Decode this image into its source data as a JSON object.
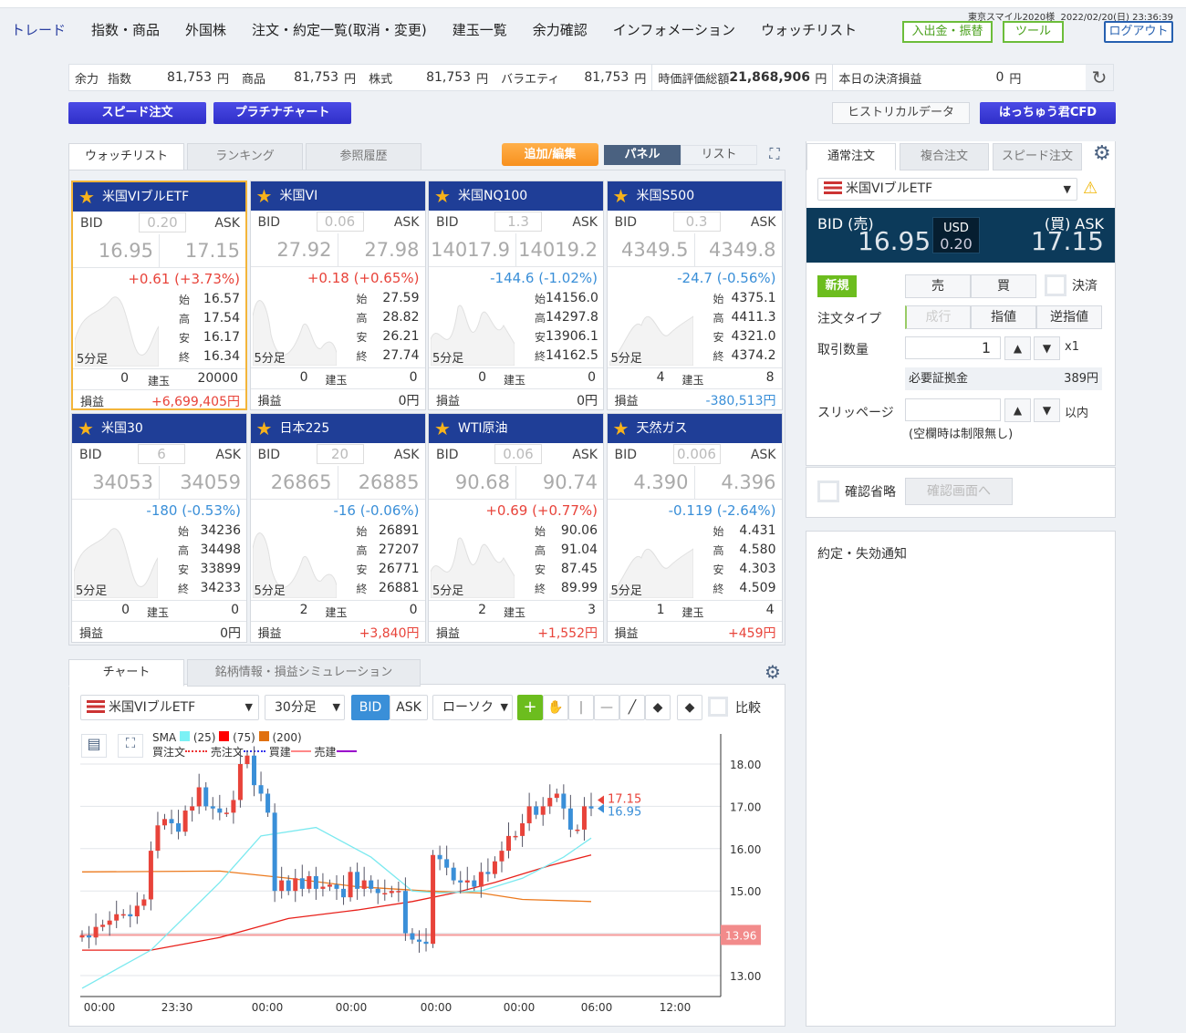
{
  "header": {
    "nav": [
      "トレード",
      "指数・商品",
      "外国株",
      "注文・約定一覧(取消・変更)",
      "建玉一覧",
      "余力確認",
      "インフォメーション",
      "ウォッチリスト"
    ],
    "user": "東京スマイル2020様",
    "datetime": "2022/02/20(日) 23:36:39",
    "deposit_btn": "入出金・振替",
    "tools_btn": "ツール",
    "logout_btn": "ログアウト"
  },
  "margin": {
    "label": "余力",
    "idx_label": "指数",
    "idx": "81,753",
    "com_label": "商品",
    "com": "81,753",
    "stk_label": "株式",
    "stk": "81,753",
    "var_label": "バラエティ",
    "var": "81,753",
    "yen": "円",
    "mv_label": "時価評価総額",
    "mv": "21,868,906",
    "pl_label": "本日の決済損益",
    "pl": "0"
  },
  "buttons": {
    "speed": "スピード注文",
    "platinum": "プラチナチャート",
    "historical": "ヒストリカルデータ",
    "hacchu": "はっちゅう君CFD"
  },
  "watch": {
    "tabs": [
      "ウォッチリスト",
      "ランキング",
      "参照履歴"
    ],
    "add_edit": "追加/編集",
    "panel": "パネル",
    "list": "リスト"
  },
  "card_labels": {
    "bid": "BID",
    "ask": "ASK",
    "o": "始",
    "h": "高",
    "l": "安",
    "c": "終",
    "k5": "5分足",
    "pos": "建玉",
    "pnl": "損益"
  },
  "cards": [
    {
      "name": "米国VIブルETF",
      "spread": "0.20",
      "bid": "16.95",
      "ask": "17.15",
      "change": "+0.61 (+3.73%)",
      "dir": "up",
      "o": "16.57",
      "h": "17.54",
      "l": "16.17",
      "c": "16.34",
      "sell": "0",
      "buy": "20000",
      "pnl": "+6,699,405円",
      "pnl_dir": "up",
      "selected": true
    },
    {
      "name": "米国VI",
      "spread": "0.06",
      "bid": "27.92",
      "ask": "27.98",
      "change": "+0.18 (+0.65%)",
      "dir": "up",
      "o": "27.59",
      "h": "28.82",
      "l": "26.21",
      "c": "27.74",
      "sell": "0",
      "buy": "0",
      "pnl": "0円",
      "pnl_dir": "flat"
    },
    {
      "name": "米国NQ100",
      "spread": "1.3",
      "bid": "14017.9",
      "ask": "14019.2",
      "change": "-144.6 (-1.02%)",
      "dir": "down",
      "o": "14156.0",
      "h": "14297.8",
      "l": "13906.1",
      "c": "14162.5",
      "sell": "0",
      "buy": "0",
      "pnl": "0円",
      "pnl_dir": "flat"
    },
    {
      "name": "米国S500",
      "spread": "0.3",
      "bid": "4349.5",
      "ask": "4349.8",
      "change": "-24.7 (-0.56%)",
      "dir": "down",
      "o": "4375.1",
      "h": "4411.3",
      "l": "4321.0",
      "c": "4374.2",
      "sell": "4",
      "buy": "8",
      "pnl": "-380,513円",
      "pnl_dir": "down"
    },
    {
      "name": "米国30",
      "spread": "6",
      "bid": "34053",
      "ask": "34059",
      "change": "-180 (-0.53%)",
      "dir": "down",
      "o": "34236",
      "h": "34498",
      "l": "33899",
      "c": "34233",
      "sell": "0",
      "buy": "0",
      "pnl": "0円",
      "pnl_dir": "flat"
    },
    {
      "name": "日本225",
      "spread": "20",
      "bid": "26865",
      "ask": "26885",
      "change": "-16 (-0.06%)",
      "dir": "down",
      "o": "26891",
      "h": "27207",
      "l": "26771",
      "c": "26881",
      "sell": "2",
      "buy": "0",
      "pnl": "+3,840円",
      "pnl_dir": "up"
    },
    {
      "name": "WTI原油",
      "spread": "0.06",
      "bid": "90.68",
      "ask": "90.74",
      "change": "+0.69 (+0.77%)",
      "dir": "up",
      "o": "90.06",
      "h": "91.04",
      "l": "87.45",
      "c": "89.99",
      "sell": "2",
      "buy": "3",
      "pnl": "+1,552円",
      "pnl_dir": "up"
    },
    {
      "name": "天然ガス",
      "spread": "0.006",
      "bid": "4.390",
      "ask": "4.396",
      "change": "-0.119 (-2.64%)",
      "dir": "down",
      "o": "4.431",
      "h": "4.580",
      "l": "4.303",
      "c": "4.509",
      "sell": "1",
      "buy": "4",
      "pnl": "+459円",
      "pnl_dir": "up"
    }
  ],
  "chart_panel": {
    "tabs": [
      "チャート",
      "銘柄情報・損益シミュレーション"
    ],
    "symbol": "米国VIブルETF",
    "interval": "30分足",
    "bid": "BID",
    "ask": "ASK",
    "type": "ローソク",
    "compare": "比較",
    "sma_label": "SMA",
    "sma25": "(25)",
    "sma75": "(75)",
    "sma200": "(200)",
    "buy_order": "買注文",
    "sell_order": "売注文",
    "buy_pos": "買建",
    "sell_pos": "売建"
  },
  "chart_data": {
    "type": "candlestick",
    "y_ticks": [
      "18.00",
      "17.00",
      "16.00",
      "15.00",
      "13.00"
    ],
    "ylim": [
      12.6,
      18.3
    ],
    "x_ticks": [
      "00:00",
      "23:30",
      "00:00",
      "00:00",
      "00:00",
      "00:00",
      "06:00",
      "12:00"
    ],
    "closes": [
      13.95,
      13.9,
      14.15,
      14.2,
      14.3,
      14.45,
      14.45,
      14.4,
      14.65,
      14.8,
      15.95,
      16.55,
      16.7,
      16.6,
      16.4,
      16.9,
      17.0,
      17.45,
      17.0,
      16.95,
      16.85,
      16.85,
      17.15,
      18.0,
      18.2,
      17.5,
      17.3,
      16.85,
      15.0,
      15.25,
      15.0,
      15.3,
      15.05,
      15.35,
      15.05,
      15.1,
      15.15,
      15.05,
      14.85,
      15.45,
      15.05,
      15.25,
      15.05,
      14.95,
      14.95,
      15.0,
      15.0,
      14.0,
      13.85,
      13.8,
      13.75,
      15.85,
      15.75,
      15.55,
      15.25,
      15.2,
      15.25,
      15.1,
      15.45,
      15.4,
      15.7,
      15.95,
      16.3,
      16.3,
      16.6,
      17.0,
      16.8,
      17.0,
      17.2,
      17.3,
      16.95,
      16.45,
      16.45,
      17.0,
      16.95
    ],
    "sma25": [
      [
        0,
        12.7
      ],
      [
        10,
        13.6
      ],
      [
        20,
        15.2
      ],
      [
        26,
        16.3
      ],
      [
        34,
        16.5
      ],
      [
        42,
        15.8
      ],
      [
        48,
        15.0
      ],
      [
        52,
        14.95
      ],
      [
        58,
        15.0
      ],
      [
        64,
        15.3
      ],
      [
        70,
        15.8
      ],
      [
        74,
        16.25
      ]
    ],
    "sma75": [
      [
        0,
        13.6
      ],
      [
        10,
        13.6
      ],
      [
        20,
        13.9
      ],
      [
        30,
        14.35
      ],
      [
        40,
        14.55
      ],
      [
        48,
        14.75
      ],
      [
        54,
        14.95
      ],
      [
        60,
        15.2
      ],
      [
        68,
        15.6
      ],
      [
        74,
        15.85
      ]
    ],
    "sma200": [
      [
        0,
        15.45
      ],
      [
        20,
        15.47
      ],
      [
        30,
        15.3
      ],
      [
        40,
        15.1
      ],
      [
        50,
        15.0
      ],
      [
        58,
        14.95
      ],
      [
        64,
        14.8
      ],
      [
        74,
        14.75
      ]
    ],
    "ask_price": "17.15",
    "bid_price": "16.95",
    "line_price": "13.96",
    "colors": {
      "up": "#e8433a",
      "down": "#3a8fd8",
      "sma25": "#7be9ef",
      "sma75": "#e8201a",
      "sma200": "#ec7a1e"
    }
  },
  "order": {
    "tabs": [
      "通常注文",
      "複合注文",
      "スピード注文"
    ],
    "symbol": "米国VIブルETF",
    "bid_label": "BID (売)",
    "ask_label": "(買) ASK",
    "bid": "16.95",
    "ask": "17.15",
    "ccy": "USD",
    "spread": "0.20",
    "new": "新規",
    "sell": "売",
    "buy": "買",
    "settle": "決済",
    "type_label": "注文タイプ",
    "market": "成行",
    "limit": "指値",
    "stop": "逆指値",
    "qty_label": "取引数量",
    "qty": "1",
    "mult": "x1",
    "req_label": "必要証拠金",
    "req": "389円",
    "slip_label": "スリッページ",
    "slip": "",
    "within": "以内",
    "slip_note": "(空欄時は制限無し)",
    "skip_confirm": "確認省略",
    "confirm": "確認画面へ"
  },
  "notice": {
    "title": "約定・失効通知"
  }
}
